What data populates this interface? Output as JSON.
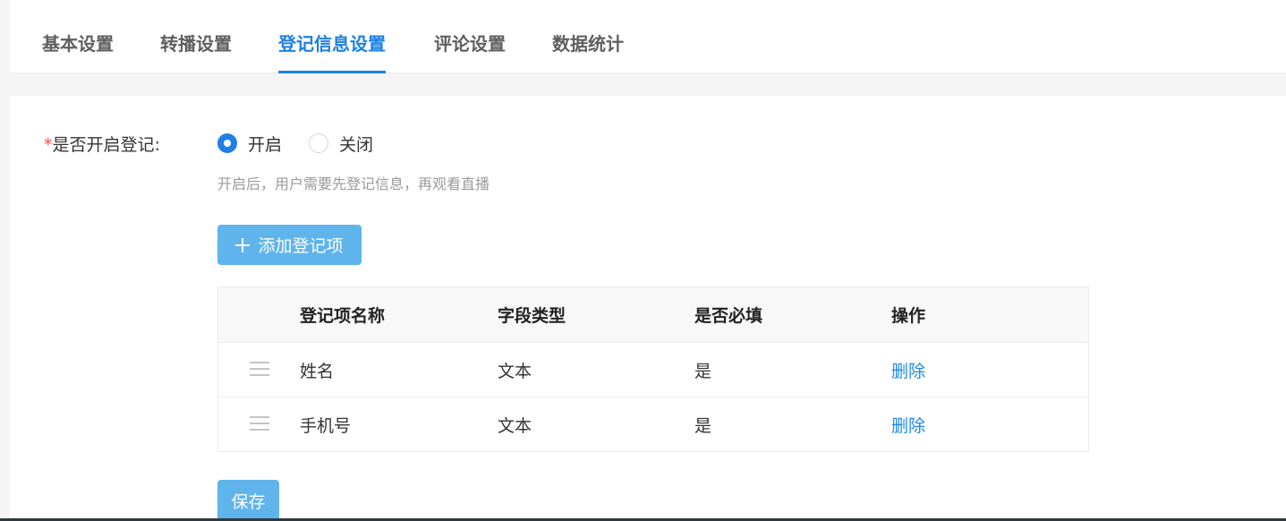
{
  "tabs": [
    {
      "label": "基本设置",
      "active": false
    },
    {
      "label": "转播设置",
      "active": false
    },
    {
      "label": "登记信息设置",
      "active": true
    },
    {
      "label": "评论设置",
      "active": false
    },
    {
      "label": "数据统计",
      "active": false
    }
  ],
  "registration": {
    "required_mark": "*",
    "label": "是否开启登记:",
    "options": [
      {
        "label": "开启",
        "checked": true
      },
      {
        "label": "关闭",
        "checked": false
      }
    ],
    "hint": "开启后，用户需要先登记信息，再观看直播"
  },
  "add_button": {
    "icon": "plus-icon",
    "label": "添加登记项"
  },
  "table": {
    "headers": [
      "登记项名称",
      "字段类型",
      "是否必填",
      "操作"
    ],
    "rows": [
      {
        "drag_icon": "drag-handle-icon",
        "name": "姓名",
        "type": "文本",
        "required": "是",
        "action": "删除"
      },
      {
        "drag_icon": "drag-handle-icon",
        "name": "手机号",
        "type": "文本",
        "required": "是",
        "action": "删除"
      }
    ]
  },
  "save_button": {
    "label": "保存"
  },
  "colors": {
    "accent": "#1e7fe6",
    "button": "#5fb4ec",
    "required": "#f04b4b",
    "link": "#1e88e5"
  }
}
